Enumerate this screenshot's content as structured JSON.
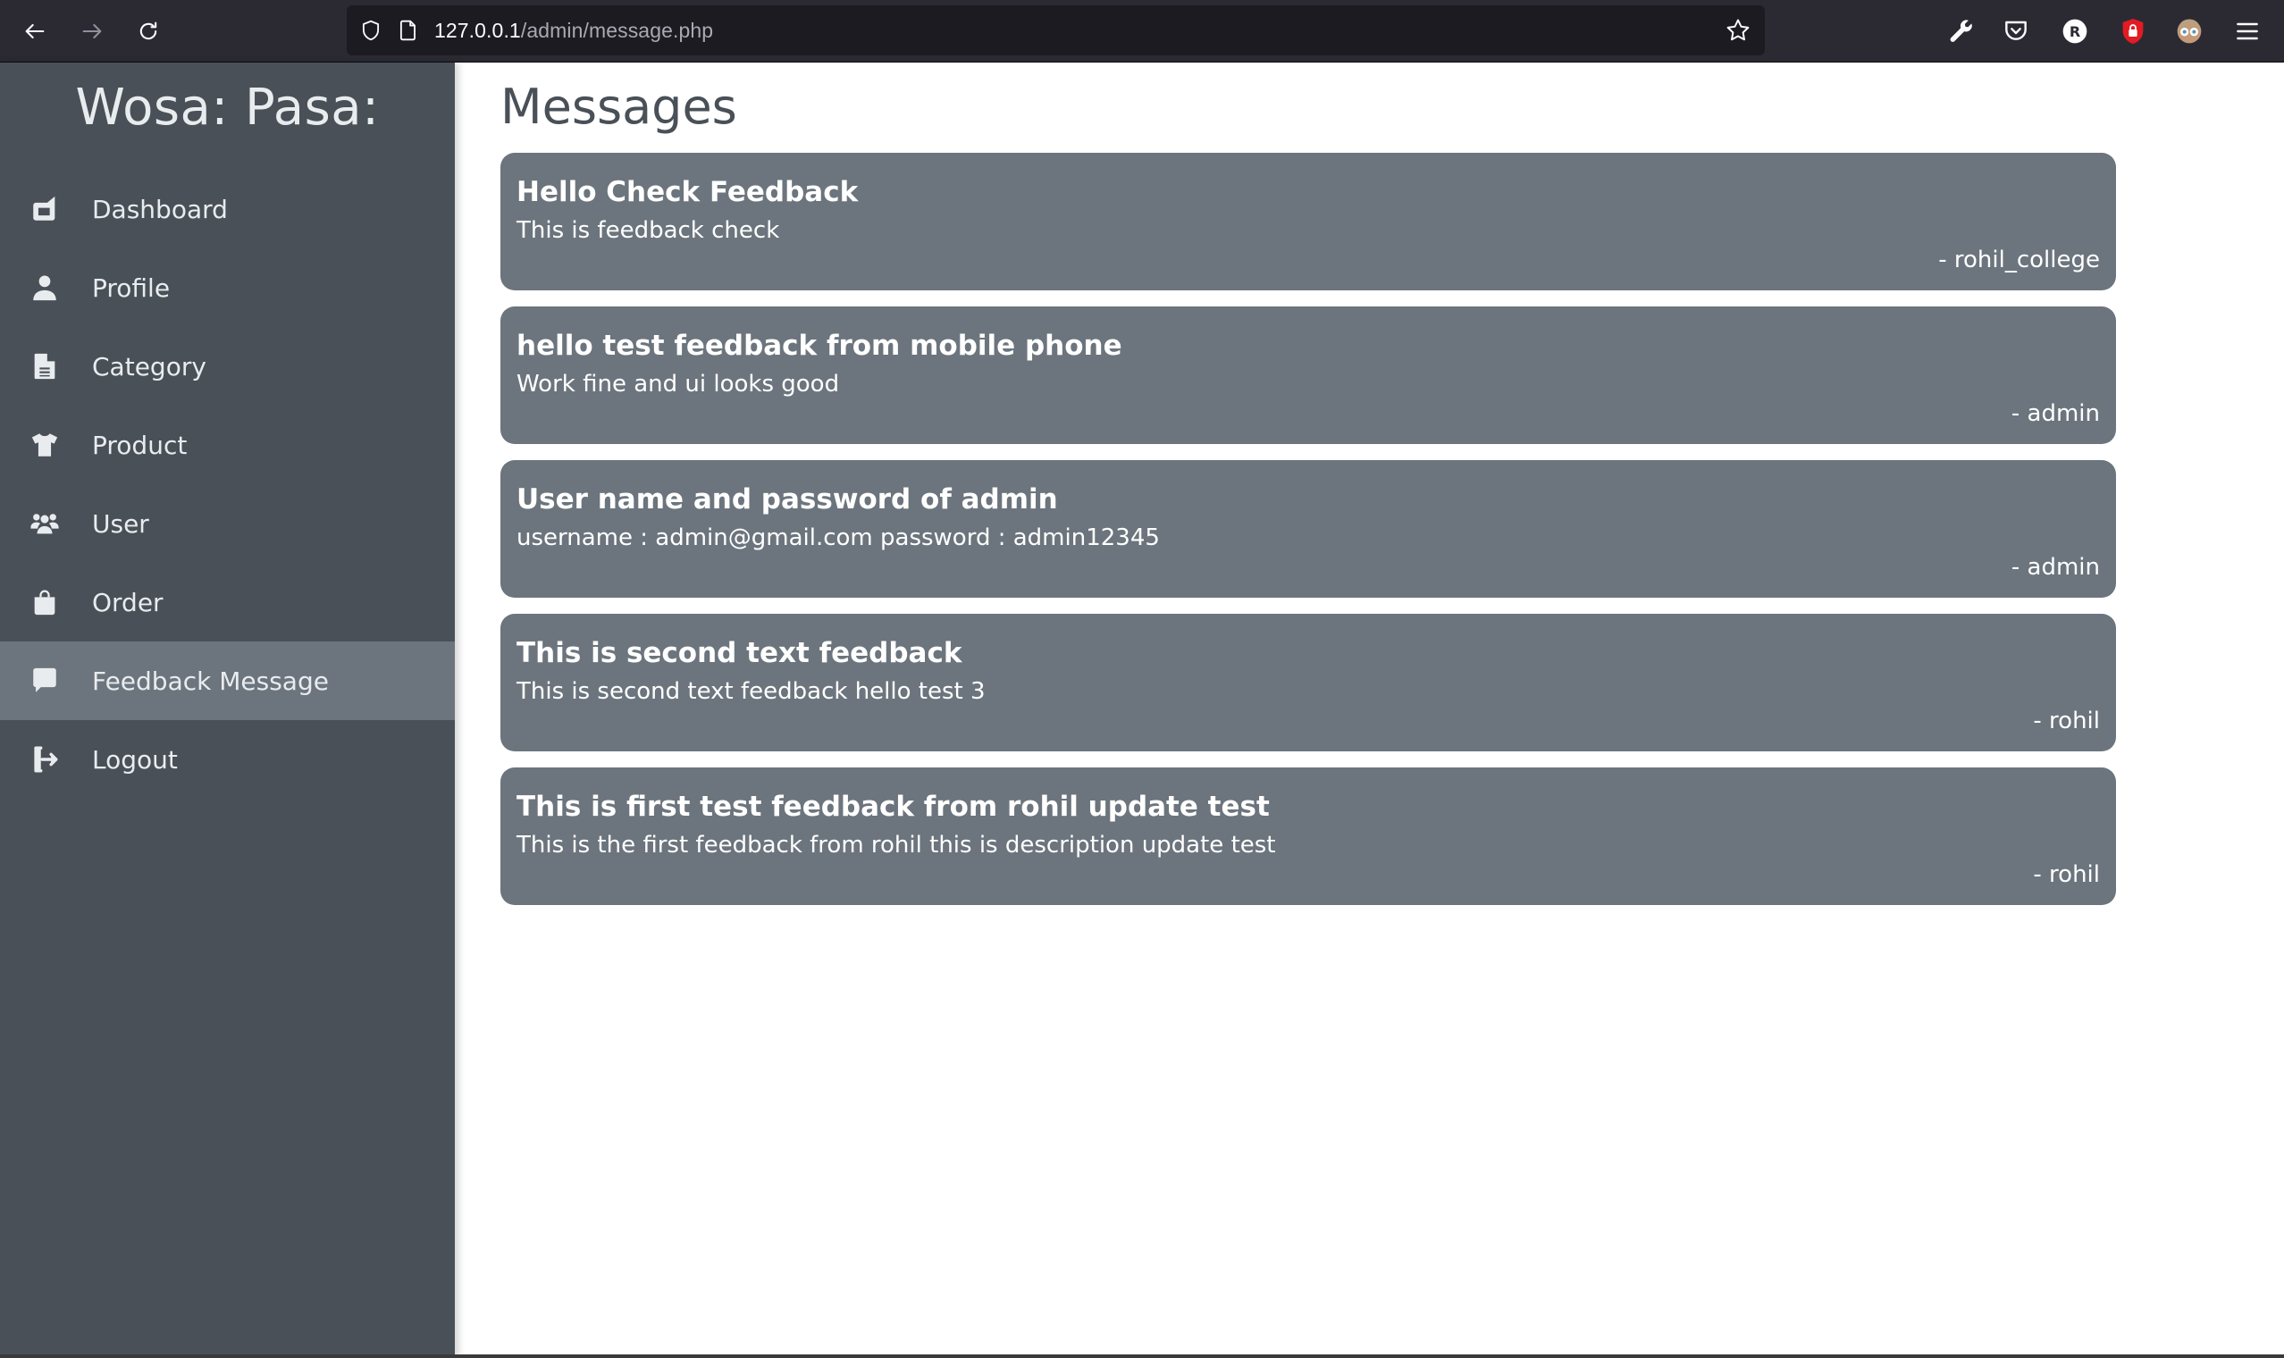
{
  "browser": {
    "url_host": "127.0.0.1",
    "url_path": "/admin/message.php",
    "profile_badge_letter": "R",
    "colors": {
      "toolbar_bg": "#2b2a33",
      "urlbar_bg": "#1c1b22",
      "shield_red": "#e31b23"
    }
  },
  "sidebar": {
    "brand": "Wosa: Pasa:",
    "items": [
      {
        "label": "Dashboard",
        "icon": "dashboard-icon",
        "active": false
      },
      {
        "label": "Profile",
        "icon": "user-icon",
        "active": false
      },
      {
        "label": "Category",
        "icon": "file-icon",
        "active": false
      },
      {
        "label": "Product",
        "icon": "shirt-icon",
        "active": false
      },
      {
        "label": "User",
        "icon": "users-icon",
        "active": false
      },
      {
        "label": "Order",
        "icon": "shopping-bag-icon",
        "active": false
      },
      {
        "label": "Feedback Message",
        "icon": "comment-icon",
        "active": true
      },
      {
        "label": "Logout",
        "icon": "logout-icon",
        "active": false
      }
    ],
    "colors": {
      "bg": "#495057",
      "active_bg": "#6c757d",
      "text": "#e9ecef"
    }
  },
  "main": {
    "title": "Messages",
    "messages": [
      {
        "title": "Hello Check Feedback",
        "body": "This is feedback check",
        "author": "- rohil_college"
      },
      {
        "title": "hello test feedback from mobile phone",
        "body": "Work fine and ui looks good",
        "author": "- admin"
      },
      {
        "title": "User name and password of admin",
        "body": "username : admin@gmail.com password : admin12345",
        "author": "- admin"
      },
      {
        "title": "This is second text feedback",
        "body": "This is second text feedback hello test 3",
        "author": "- rohil"
      },
      {
        "title": "This is first test feedback from rohil update test",
        "body": "This is the first feedback from rohil this is description update test",
        "author": "- rohil"
      }
    ],
    "colors": {
      "card_bg": "#6c757d",
      "card_text": "#ffffff",
      "title_text": "#495057"
    }
  }
}
